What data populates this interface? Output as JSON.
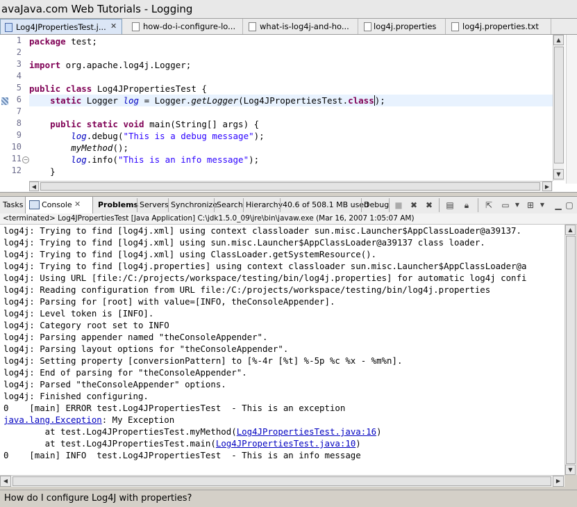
{
  "window": {
    "title": "avaJava.com Web Tutorials - Logging"
  },
  "editor_tabs": [
    {
      "label": "Log4JPropertiesTest.j...",
      "close": "✕",
      "icon": "java-file-icon"
    },
    {
      "label": "how-do-i-configure-lo...",
      "icon": "text-file-icon"
    },
    {
      "label": "what-is-log4j-and-ho...",
      "icon": "text-file-icon"
    },
    {
      "label": "log4j.properties",
      "icon": "properties-file-icon"
    },
    {
      "label": "log4j.properties.txt",
      "icon": "text-file-icon"
    }
  ],
  "editor": {
    "line_numbers": [
      "1",
      "2",
      "3",
      "4",
      "5",
      "6",
      "7",
      "8",
      "9",
      "10",
      "11",
      "12"
    ],
    "code": {
      "l1_kw": "package",
      "l1_rest": " test;",
      "l3_kw": "import",
      "l3_rest": " org.apache.log4j.Logger;",
      "l5_kw1": "public",
      "l5_kw2": "class",
      "l5_rest": " Log4JPropertiesTest {",
      "l6_kw": "static",
      "l6_a": " Logger ",
      "l6_field": "log",
      "l6_b": " = Logger.",
      "l6_method": "getLogger",
      "l6_c": "(Log4JPropertiesTest.",
      "l6_kw2": "class",
      "l6_d": ");",
      "l8_kw1": "public",
      "l8_kw2": "static",
      "l8_kw3": "void",
      "l8_rest": " main(String[] args) {",
      "l9_field": "log",
      "l9_a": ".debug(",
      "l9_str": "\"This is a debug message\"",
      "l9_b": ");",
      "l10_method": "myMethod",
      "l10_a": "();",
      "l11_field": "log",
      "l11_a": ".info(",
      "l11_str": "\"This is an info message\"",
      "l11_b": ");",
      "l12": "}"
    }
  },
  "console_tabs": {
    "tasks": "Tasks",
    "console": "Console",
    "console_close": "✕",
    "problems": "Problems",
    "servers": "Servers",
    "synchronize": "Synchronize",
    "search": "Search",
    "hierarchy": "Hierarchy",
    "memory": "40.6 of 508.1 MB used",
    "debug": "Debug"
  },
  "console_status": "<terminated> Log4JPropertiesTest [Java Application] C:\\jdk1.5.0_09\\jre\\bin\\javaw.exe (Mar 16, 2007 1:05:07 AM)",
  "console_lines": [
    "log4j: Trying to find [log4j.xml] using context classloader sun.misc.Launcher$AppClassLoader@a39137.",
    "log4j: Trying to find [log4j.xml] using sun.misc.Launcher$AppClassLoader@a39137 class loader.",
    "log4j: Trying to find [log4j.xml] using ClassLoader.getSystemResource().",
    "log4j: Trying to find [log4j.properties] using context classloader sun.misc.Launcher$AppClassLoader@a",
    "log4j: Using URL [file:/C:/projects/workspace/testing/bin/log4j.properties] for automatic log4j confi",
    "log4j: Reading configuration from URL file:/C:/projects/workspace/testing/bin/log4j.properties",
    "log4j: Parsing for [root] with value=[INFO, theConsoleAppender].",
    "log4j: Level token is [INFO].",
    "log4j: Category root set to INFO",
    "log4j: Parsing appender named \"theConsoleAppender\".",
    "log4j: Parsing layout options for \"theConsoleAppender\".",
    "log4j: Setting property [conversionPattern] to [%-4r [%t] %-5p %c %x - %m%n].",
    "log4j: End of parsing for \"theConsoleAppender\".",
    "log4j: Parsed \"theConsoleAppender\" options.",
    "log4j: Finished configuring.",
    "0    [main] ERROR test.Log4JPropertiesTest  - This is an exception"
  ],
  "exception": {
    "class_link": "java.lang.Exception",
    "message": ": My Exception",
    "frame1_prefix": "        at test.Log4JPropertiesTest.myMethod(",
    "frame1_link": "Log4JPropertiesTest.java:16",
    "frame1_suffix": ")",
    "frame2_prefix": "        at test.Log4JPropertiesTest.main(",
    "frame2_link": "Log4JPropertiesTest.java:10",
    "frame2_suffix": ")"
  },
  "console_last_line": "0    [main] INFO  test.Log4JPropertiesTest  - This is an info message",
  "status_bar": {
    "text": "How do I configure Log4J with properties?"
  },
  "colors": {
    "keyword": "#7f0055",
    "string": "#2a00ff",
    "field": "#0000c0",
    "link": "#0000c0",
    "current_line": "#e8f2fe"
  }
}
